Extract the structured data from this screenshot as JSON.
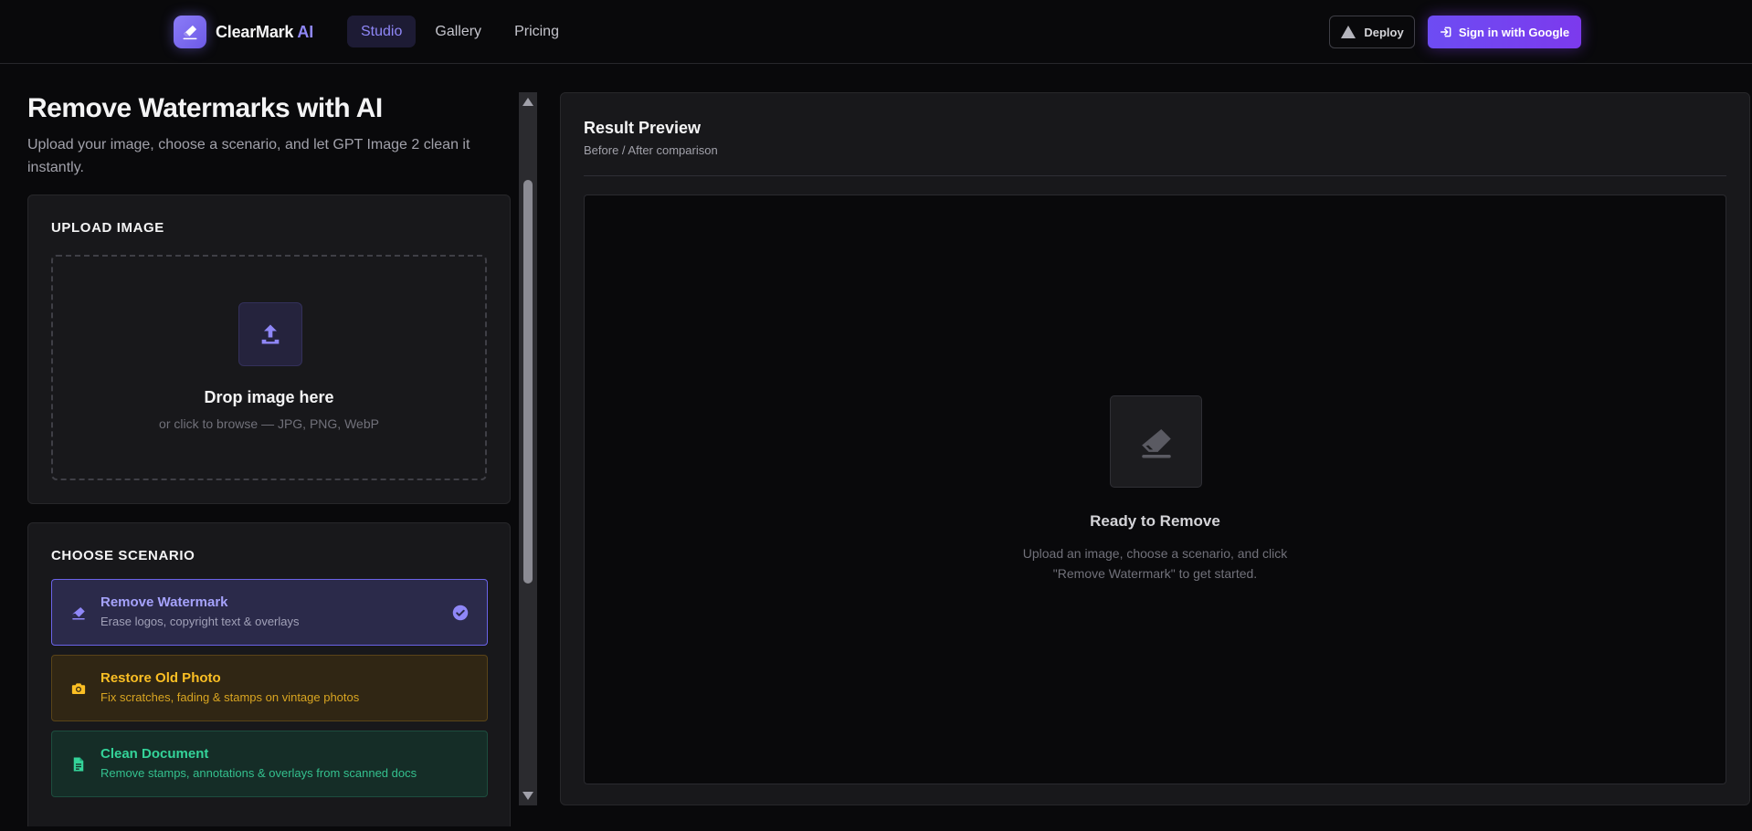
{
  "brand": {
    "name": "ClearMark",
    "suffix": "AI"
  },
  "nav": {
    "items": [
      {
        "label": "Studio",
        "active": true
      },
      {
        "label": "Gallery",
        "active": false
      },
      {
        "label": "Pricing",
        "active": false
      }
    ]
  },
  "header": {
    "deploy_label": "Deploy",
    "signin_label": "Sign in with Google"
  },
  "page": {
    "title": "Remove Watermarks with AI",
    "subtitle": "Upload your image, choose a scenario, and let GPT Image 2 clean it instantly."
  },
  "upload": {
    "section_title": "UPLOAD IMAGE",
    "drop_title": "Drop image here",
    "drop_sub": "or click to browse — JPG, PNG, WebP"
  },
  "scenarios": {
    "section_title": "CHOOSE SCENARIO",
    "items": [
      {
        "title": "Remove Watermark",
        "desc": "Erase logos, copyright text & overlays",
        "selected": true,
        "icon": "eraser-icon"
      },
      {
        "title": "Restore Old Photo",
        "desc": "Fix scratches, fading & stamps on vintage photos",
        "selected": false,
        "icon": "camera-icon"
      },
      {
        "title": "Clean Document",
        "desc": "Remove stamps, annotations & overlays from scanned docs",
        "selected": false,
        "icon": "document-icon"
      }
    ]
  },
  "result": {
    "title": "Result Preview",
    "subtitle": "Before / After comparison",
    "empty_title": "Ready to Remove",
    "empty_desc_line1": "Upload an image, choose a scenario, and click",
    "empty_desc_line2": "\"Remove Watermark\" to get started."
  },
  "colors": {
    "accent": "#6d4cf3",
    "accent_text": "#8f87f7",
    "warning": "#fbbf24",
    "success": "#34d399",
    "background": "#09090b",
    "card": "#18181b"
  }
}
